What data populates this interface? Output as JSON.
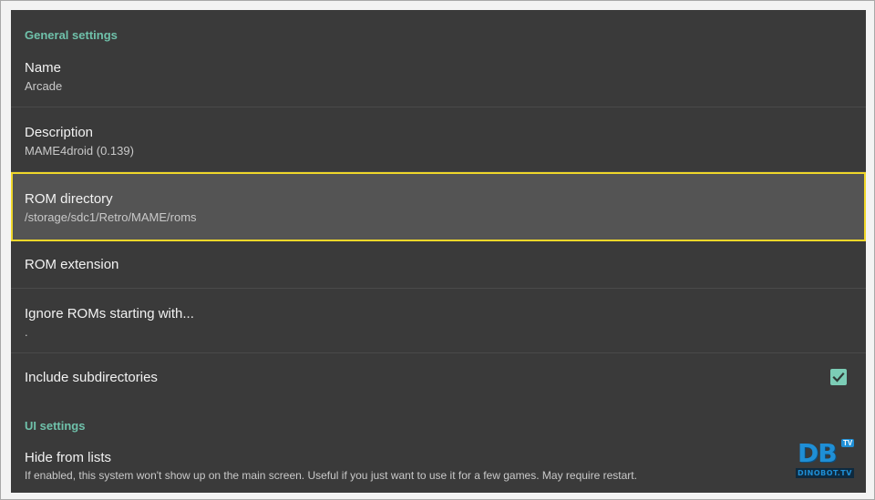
{
  "sections": {
    "general_label": "General settings",
    "ui_label": "UI settings"
  },
  "items": {
    "name": {
      "title": "Name",
      "value": "Arcade"
    },
    "description": {
      "title": "Description",
      "value": "MAME4droid (0.139)"
    },
    "rom_directory": {
      "title": "ROM directory",
      "value": "/storage/sdc1/Retro/MAME/roms"
    },
    "rom_extension": {
      "title": "ROM extension"
    },
    "ignore_roms": {
      "title": "Ignore ROMs starting with...",
      "value": "."
    },
    "include_subdirectories": {
      "title": "Include subdirectories",
      "checked": true
    },
    "hide_from_lists": {
      "title": "Hide from lists",
      "value": "If enabled, this system won't show up on the main screen. Useful if you just want to use it for a few games. May require restart."
    }
  },
  "watermark": {
    "logo_text": "DB",
    "badge": "TV",
    "site": "DINOBOT.TV"
  },
  "colors": {
    "accent": "#6fc1aa",
    "checkbox": "#7ccdb6",
    "focus_outline": "#f0d72a",
    "panel_bg": "#3a3a3a",
    "selected_bg": "#545454"
  }
}
